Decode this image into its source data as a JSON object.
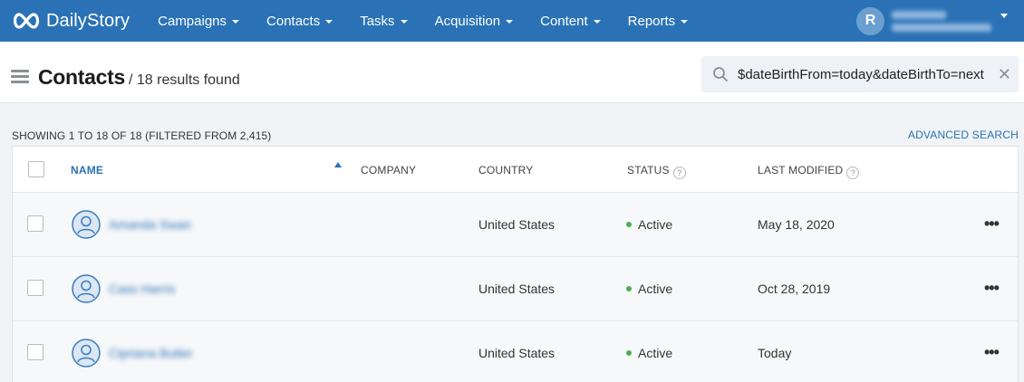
{
  "app": {
    "name": "DailyStory"
  },
  "nav": {
    "items": [
      {
        "label": "Campaigns"
      },
      {
        "label": "Contacts"
      },
      {
        "label": "Tasks"
      },
      {
        "label": "Acquisition"
      },
      {
        "label": "Content"
      },
      {
        "label": "Reports"
      }
    ],
    "user_initial": "R"
  },
  "header": {
    "title": "Contacts",
    "results": "/ 18 results found"
  },
  "search": {
    "value": "$dateBirthFrom=today&dateBirthTo=next"
  },
  "subheader": {
    "showing": "SHOWING 1 TO 18 OF 18 (FILTERED FROM 2,415)",
    "advanced_search": "ADVANCED SEARCH"
  },
  "table": {
    "columns": {
      "name": "NAME",
      "company": "COMPANY",
      "country": "COUNTRY",
      "status": "STATUS",
      "last_modified": "LAST MODIFIED"
    },
    "rows": [
      {
        "name": "Amanda Swan",
        "country": "United States",
        "status": "Active",
        "last_modified": "May 18, 2020"
      },
      {
        "name": "Cass Harris",
        "country": "United States",
        "status": "Active",
        "last_modified": "Oct 28, 2019"
      },
      {
        "name": "Cipriana Butler",
        "country": "United States",
        "status": "Active",
        "last_modified": "Today"
      }
    ]
  },
  "colors": {
    "brand": "#2a72b5",
    "active": "#4caf50"
  }
}
